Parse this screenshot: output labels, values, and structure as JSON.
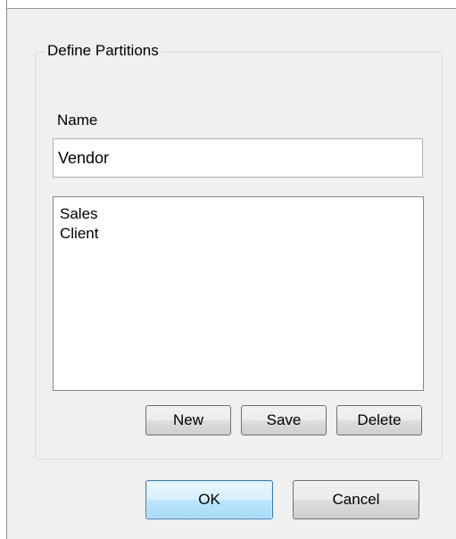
{
  "group": {
    "title": "Define Partitions"
  },
  "name_field": {
    "label": "Name",
    "value": "Vendor"
  },
  "partitions": {
    "items": [
      "Sales",
      "Client"
    ]
  },
  "actions": {
    "new_label": "New",
    "save_label": "Save",
    "delete_label": "Delete"
  },
  "footer": {
    "ok_label": "OK",
    "cancel_label": "Cancel"
  }
}
